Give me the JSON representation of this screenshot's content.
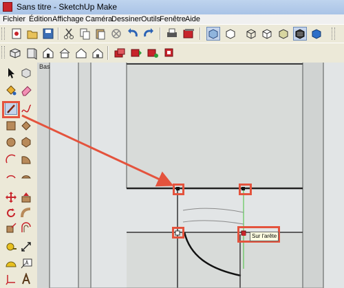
{
  "window": {
    "title": "Sans titre - SketchUp Make"
  },
  "menu": [
    "Fichier",
    "Édition",
    "Affichage",
    "Caméra",
    "Dessiner",
    "Outils",
    "Fenêtre",
    "Aide"
  ],
  "viewport": {
    "view_label": "Bas",
    "inference_tooltip": "Sur l'arête"
  },
  "icons": {
    "toolbar_row1": [
      "new-icon",
      "open-icon",
      "save-icon",
      "cut-icon",
      "copy-icon",
      "paste-icon",
      "erase-icon",
      "undo-icon",
      "redo-icon",
      "print-icon",
      "model-info-icon",
      "xray-icon",
      "back-edges-icon",
      "wireframe-icon",
      "hidden-line-icon",
      "shaded-icon",
      "shaded-textures-icon",
      "monochrome-icon"
    ],
    "toolbar_row2": [
      "iso-view-icon",
      "top-view-icon",
      "front-view-icon",
      "right-view-icon",
      "back-view-icon",
      "left-view-icon",
      "warehouse-icon",
      "share-model-icon",
      "components-icon",
      "extension-icon"
    ],
    "tools": [
      "select-icon",
      "make-component-icon",
      "paint-bucket-icon",
      "eraser-icon",
      "line-icon",
      "freehand-icon",
      "rectangle-icon",
      "rotated-rectangle-icon",
      "circle-icon",
      "polygon-icon",
      "arc-icon",
      "pie-icon",
      "two-point-arc-icon",
      "three-point-arc-icon",
      "move-icon",
      "push-pull-icon",
      "rotate-icon",
      "follow-me-icon",
      "scale-icon",
      "offset-icon",
      "tape-measure-icon",
      "dimension-icon",
      "protractor-icon",
      "text-icon",
      "axes-icon",
      "3d-text-icon"
    ]
  },
  "colors": {
    "callout": "#e4533d",
    "inference_green": "#44c13a",
    "accent": "#c8242b"
  }
}
